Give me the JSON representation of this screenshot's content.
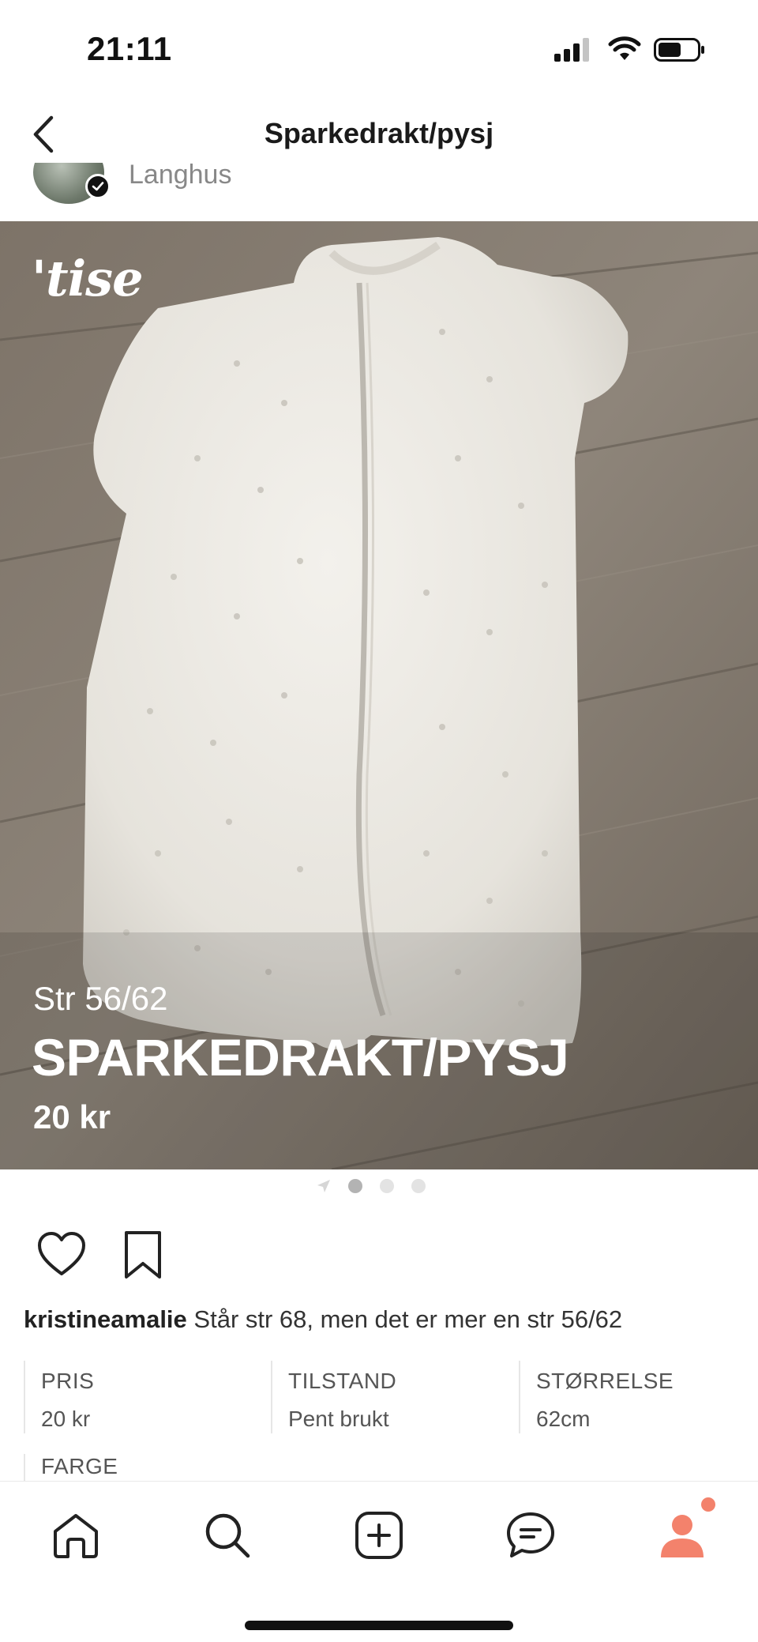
{
  "status_bar": {
    "time": "21:11"
  },
  "header": {
    "title": "Sparkedrakt/pysj",
    "back_icon": "chevron-left-icon"
  },
  "seller": {
    "name": "Langhus",
    "verified_icon": "checkmark-icon"
  },
  "product_image": {
    "brand_watermark": "'tise",
    "overlay_size": "Str 56/62",
    "overlay_title": "SPARKEDRAKT/PYSJ",
    "overlay_price": "20 kr"
  },
  "pager": {
    "count": 3,
    "active_index": 0
  },
  "actions": {
    "like_icon": "heart-icon",
    "save_icon": "bookmark-icon"
  },
  "description": {
    "username": "kristineamalie",
    "text": "Står str 68, men det er mer en str 56/62"
  },
  "details": [
    {
      "label": "PRIS",
      "value": "20 kr"
    },
    {
      "label": "TILSTAND",
      "value": "Pent brukt"
    },
    {
      "label": "STØRRELSE",
      "value": "62cm"
    }
  ],
  "details_partial": {
    "label": "FARGE"
  },
  "tab_bar": {
    "items": [
      {
        "name": "home",
        "icon": "home-icon"
      },
      {
        "name": "search",
        "icon": "search-icon"
      },
      {
        "name": "add",
        "icon": "plus-square-icon"
      },
      {
        "name": "messages",
        "icon": "chat-icon"
      },
      {
        "name": "profile",
        "icon": "profile-icon"
      }
    ],
    "accent_color": "#f3826c"
  }
}
